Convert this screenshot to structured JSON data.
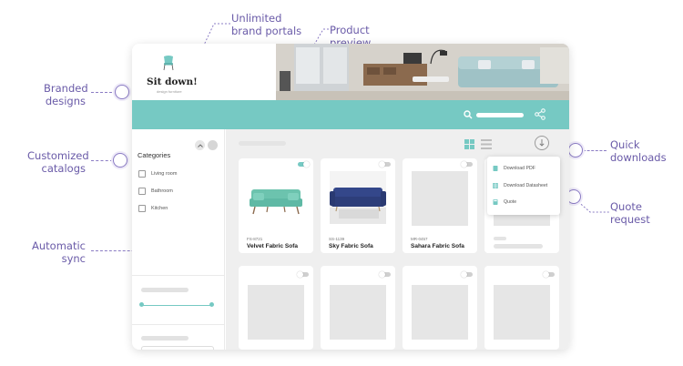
{
  "callouts": {
    "branded_designs": "Branded\ndesigns",
    "unlimited_brand_portals": "Unlimited\nbrand portals",
    "product_preview": "Product preview",
    "customized_catalogs": "Customized\ncatalogs",
    "quick_downloads": "Quick\ndownloads",
    "quote_request": "Quote\nrequest",
    "automatic_sync": "Automatic\nsync"
  },
  "brand": {
    "name": "Sit down!",
    "tagline": "design furniture"
  },
  "sidebar": {
    "title": "Categories",
    "categories": [
      "Living room",
      "Bathroom",
      "Kitchen"
    ]
  },
  "products": [
    {
      "sku": "FS-8721",
      "name": "Velvet Fabric Sofa",
      "enabled": true
    },
    {
      "sku": "SS-1139",
      "name": "Sky Fabric Sofa",
      "enabled": false
    },
    {
      "sku": "MR-0457",
      "name": "Sahara Fabric Sofa",
      "enabled": false
    }
  ],
  "download_menu": {
    "items": [
      "Download PDF",
      "Download Datasheet",
      "Quote"
    ]
  },
  "colors": {
    "accent_teal": "#76c9c3",
    "callout_purple": "#6a5ba8",
    "sofa_green": "#5fb9a5",
    "sofa_navy": "#2d3e7a"
  }
}
